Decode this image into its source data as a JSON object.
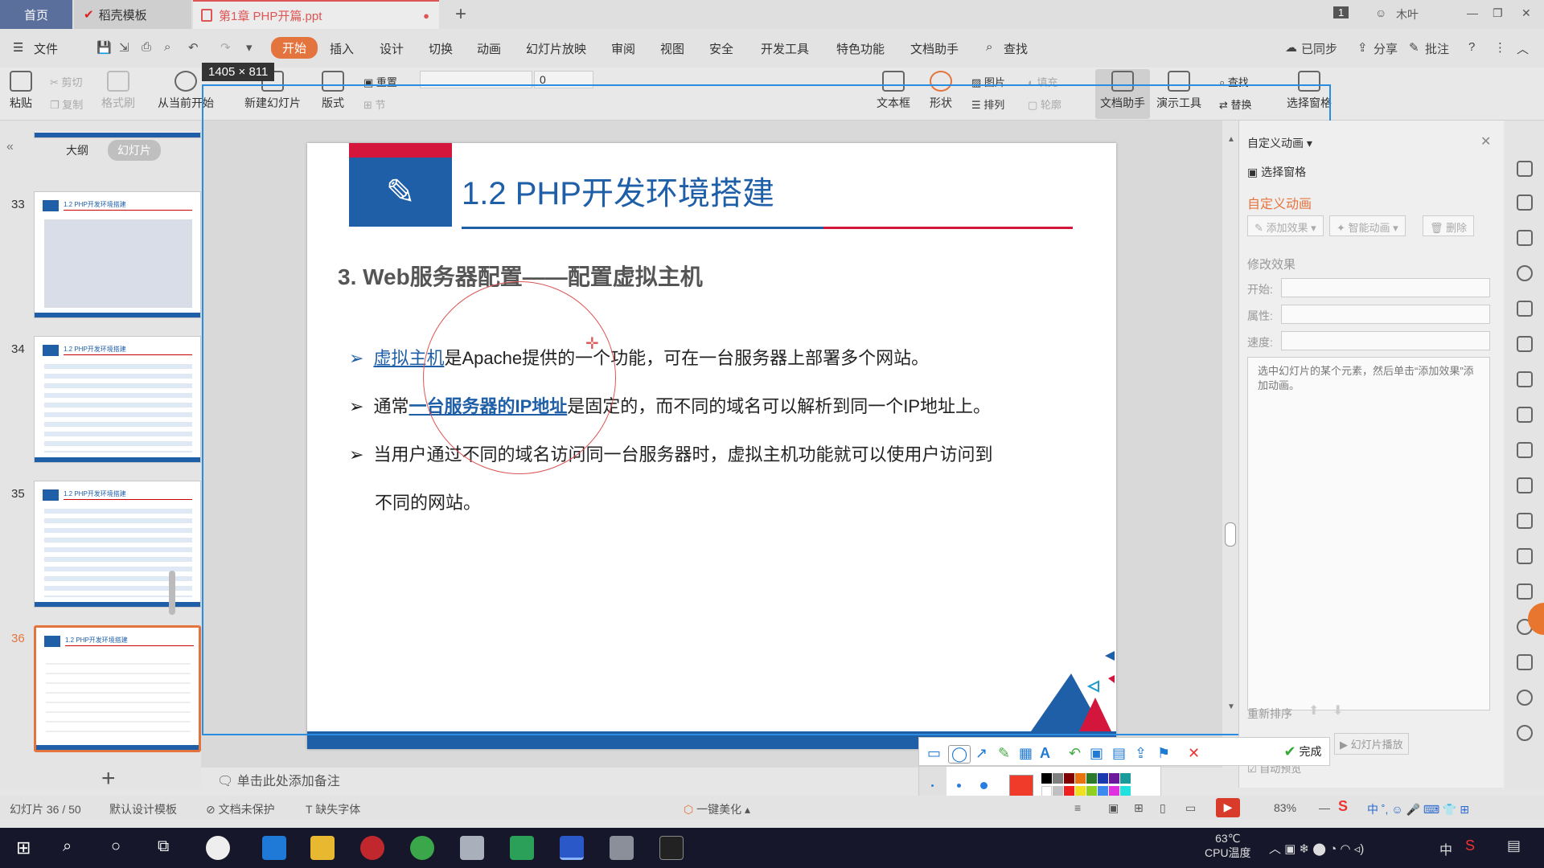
{
  "titlebar": {
    "tab_home": "首页",
    "tab_template": "稻壳模板",
    "tab_doc": "第1章 PHP开篇.ppt",
    "user": "木叶",
    "badge": "1"
  },
  "menubar": {
    "file": "文件",
    "items": [
      "开始",
      "插入",
      "设计",
      "切换",
      "动画",
      "幻灯片放映",
      "审阅",
      "视图",
      "安全",
      "开发工具",
      "特色功能",
      "文档助手"
    ],
    "search": "查找",
    "sync": "已同步",
    "share": "分享",
    "annotate": "批注"
  },
  "ribbon": {
    "paste": "粘贴",
    "cut": "剪切",
    "copy": "复制",
    "format_painter": "格式刷",
    "from_current": "从当前开始",
    "new_slide": "新建幻灯片",
    "layout": "版式",
    "reset": "重置",
    "section": "节",
    "font_size": "0",
    "textbox": "文本框",
    "shape": "形状",
    "arrange": "排列",
    "picture": "图片",
    "fill": "填充",
    "outline": "轮廓",
    "doc_helper": "文档助手",
    "present_tools": "演示工具",
    "find": "查找",
    "replace": "替换",
    "select_pane": "选择窗格"
  },
  "leftpanel": {
    "tab_outline": "大纲",
    "tab_slides": "幻灯片",
    "thumbs": [
      {
        "num": "33",
        "title": "1.2 PHP开发环境搭建"
      },
      {
        "num": "34",
        "title": "1.2 PHP开发环境搭建"
      },
      {
        "num": "35",
        "title": "1.2 PHP开发环境搭建"
      },
      {
        "num": "36",
        "title": "1.2 PHP开发环境搭建"
      }
    ]
  },
  "slide": {
    "title": "1.2 PHP开发环境搭建",
    "heading": "3.   Web服务器配置——配置虚拟主机",
    "b1_link": "虚拟主机",
    "b1_rest": "是Apache提供的一个功能，可在一台服务器上部署多个网站。",
    "b2_pre": "通常",
    "b2_link": "一台服务器的IP地址",
    "b2_rest": "是固定的，而不同的域名可以解析到同一个IP地址上。",
    "b3_line1": "当用户通过不同的域名访问同一台服务器时，虚拟主机功能就可以使用户访问到",
    "b3_line2": "不同的网站。",
    "arrow": "➢"
  },
  "selection": {
    "label": "1405 × 811"
  },
  "notes": {
    "placeholder": "单击此处添加备注"
  },
  "rightpanel": {
    "title": "自定义动画",
    "select_pane": "选择窗格",
    "custom_anim": "自定义动画",
    "add_effect": "添加效果",
    "smart_anim": "智能动画",
    "delete": "删除",
    "modify": "修改效果",
    "start": "开始:",
    "property": "属性:",
    "speed": "速度:",
    "hint": "选中幻灯片的某个元素，然后单击“添加效果”添加动画。",
    "reorder": "重新排序",
    "slideshow": "幻灯片播放",
    "autopreview": "自动预览"
  },
  "annot": {
    "done": "完成"
  },
  "statusbar": {
    "slide_count": "幻灯片 36 / 50",
    "template": "默认设计模板",
    "protect": "文档未保护",
    "font_missing": "缺失字体",
    "beautify": "一键美化",
    "zoom": "83%"
  },
  "taskbar": {
    "temp": "63℃",
    "cpu": "CPU温度",
    "ime": "中"
  },
  "colors": {
    "accent": "#e4743e",
    "slide_blue": "#1f5fa8",
    "slide_red": "#d4163c",
    "annot_red": "#f03a2a"
  }
}
